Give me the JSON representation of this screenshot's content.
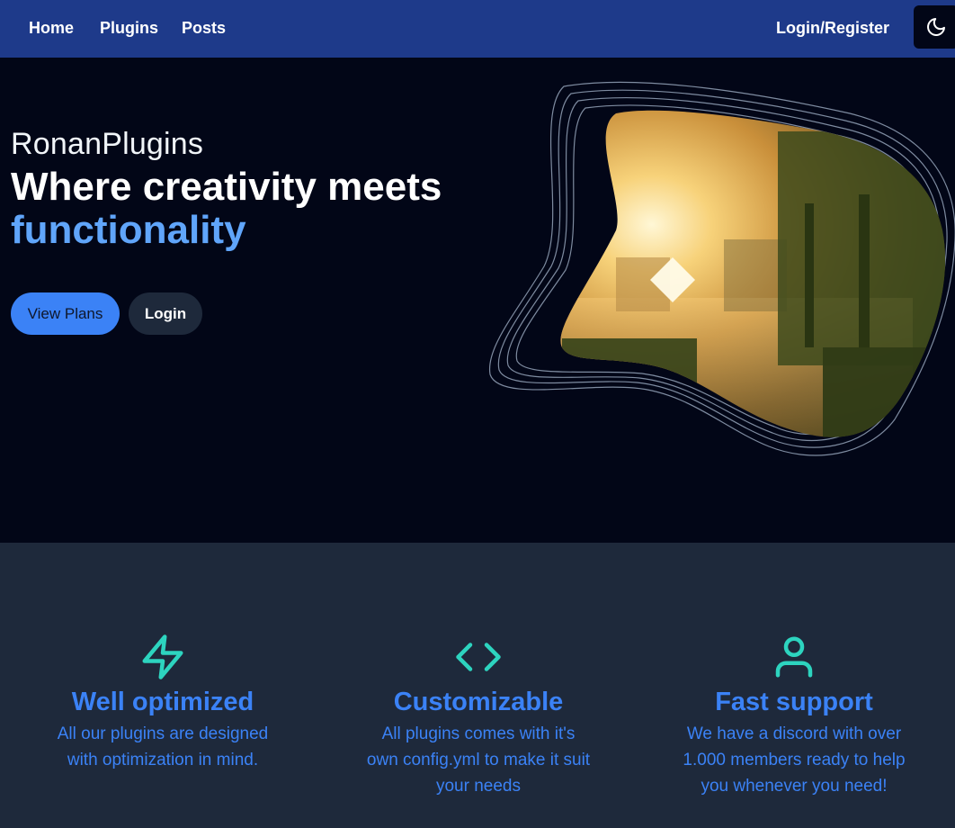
{
  "nav": {
    "links": [
      "Home",
      "Plugins",
      "Posts"
    ],
    "login": "Login/Register",
    "theme_icon": "moon-icon"
  },
  "hero": {
    "brand": "RonanPlugins",
    "headline": "Where creativity meets",
    "headline_accent": "functionality",
    "primary_button": "View Plans",
    "secondary_button": "Login",
    "image": "minecraft-sunset-landscape"
  },
  "features": [
    {
      "icon": "lightning-icon",
      "title": "Well optimized",
      "desc": "All our plugins are designed with optimization in mind."
    },
    {
      "icon": "code-icon",
      "title": "Customizable",
      "desc": "All plugins comes with it's own config.yml to make it suit your needs"
    },
    {
      "icon": "user-icon",
      "title": "Fast support",
      "desc": "We have a discord with over 1.000 members ready to help you whenever you need!"
    }
  ],
  "colors": {
    "nav_bg": "#1e3a8a",
    "hero_bg": "#020617",
    "section_bg": "#1e293b",
    "accent": "#3b82f6",
    "accent_light": "#60a5fa",
    "icon_teal": "#2dd4bf"
  }
}
